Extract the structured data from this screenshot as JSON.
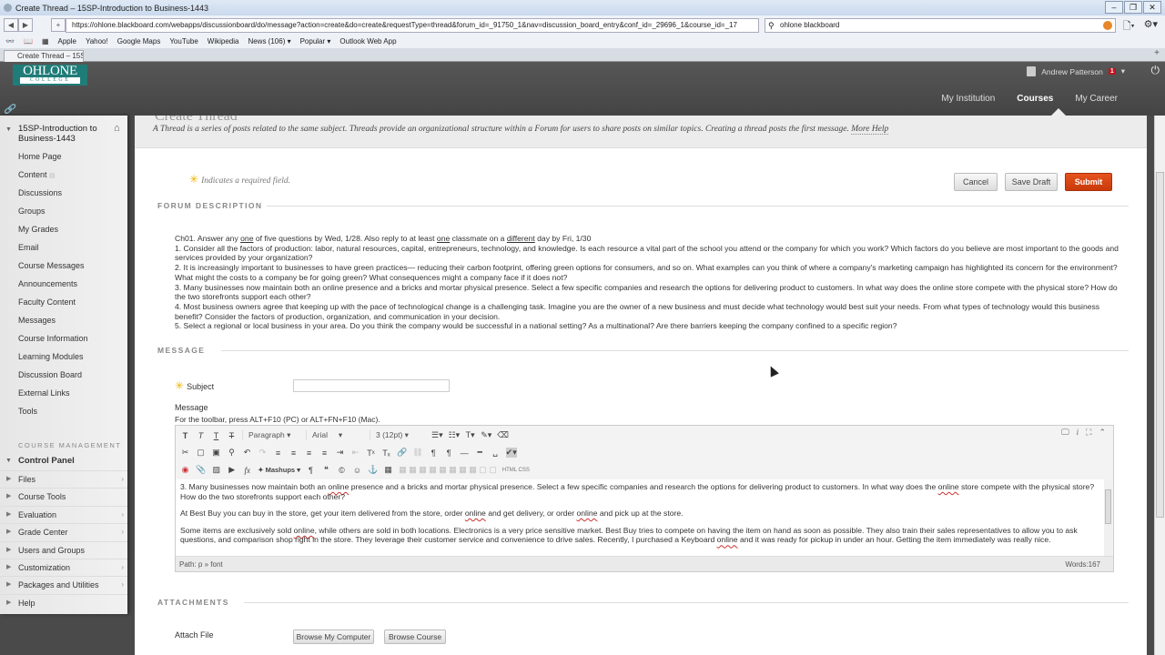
{
  "browser": {
    "window_title": "Create Thread – 15SP-Introduction to Business-1443",
    "url": "https://ohlone.blackboard.com/webapps/discussionboard/do/message?action=create&do=create&requestType=thread&forum_id=_91750_1&nav=discussion_board_entry&conf_id=_29696_1&course_id=_17",
    "search_value": "ohlone blackboard",
    "bookmarks": [
      "Apple",
      "Yahoo!",
      "Google Maps",
      "YouTube",
      "Wikipedia",
      "News (106) ▾",
      "Popular ▾",
      "Outlook Web App"
    ],
    "tab_label": "Create Thread – 15SP-1..."
  },
  "header": {
    "logo_top": "OHLONE",
    "logo_bottom": "COLLEGE",
    "user_name": "Andrew Patterson",
    "notification_count": "1",
    "nav": [
      "My Institution",
      "Courses",
      "My Career"
    ],
    "active_nav": "Courses",
    "brand_color": "#1f7c78"
  },
  "sidebar": {
    "course_title": "15SP-Introduction to Business-1443",
    "items": [
      "Home Page",
      "Content",
      "Discussions",
      "Groups",
      "My Grades",
      "Email",
      "Course Messages",
      "Announcements",
      "Faculty Content",
      "Messages",
      "Course Information",
      "Learning Modules",
      "Discussion Board",
      "External Links",
      "Tools"
    ],
    "management_label": "COURSE MANAGEMENT",
    "control_panel": "Control Panel",
    "cp_items": [
      {
        "label": "Files",
        "chevron": "›"
      },
      {
        "label": "Course Tools",
        "chevron": ""
      },
      {
        "label": "Evaluation",
        "chevron": "›"
      },
      {
        "label": "Grade Center",
        "chevron": "›"
      },
      {
        "label": "Users and Groups",
        "chevron": ""
      },
      {
        "label": "Customization",
        "chevron": "›"
      },
      {
        "label": "Packages and Utilities",
        "chevron": "›"
      },
      {
        "label": "Help",
        "chevron": ""
      }
    ]
  },
  "page": {
    "title": "Create Thread",
    "intro": "A Thread is a series of posts related to the same subject. Threads provide an organizational structure within a Forum for users to share posts on similar topics. Creating a thread posts the first message.",
    "more_help": "More Help",
    "required_note": "Indicates a required field.",
    "buttons": {
      "cancel": "Cancel",
      "save_draft": "Save Draft",
      "submit": "Submit"
    },
    "submit_color": "#d9461a"
  },
  "forum_description": {
    "heading": "FORUM DESCRIPTION",
    "line0_a": "Ch01. Answer any ",
    "line0_u1": "one",
    "line0_b": " of five questions by Wed, 1/28. Also reply to at least ",
    "line0_u2": "one",
    "line0_c": " classmate on a ",
    "line0_u3": "different",
    "line0_d": " day by Fri, 1/30",
    "questions": [
      "1. Consider all the factors of production: labor, natural resources, capital, entrepreneurs, technology, and knowledge. Is each resource a vital part of the school you attend or the company for which you work? Which factors do you believe are most important to the goods and services provided by your organization?",
      "2. It is increasingly important to businesses to have green practices— reducing their carbon footprint, offering green options for consumers, and so on. What examples can you think of where a company's marketing campaign has highlighted its concern for the environment? What might the costs to a company be for going green? What consequences might a company face if it does not?",
      "3. Many businesses now maintain both an online presence and a bricks and mortar physical presence. Select a few specific companies and research the options for delivering product to customers. In what way does the online store compete with the physical store? How do the two storefronts support each other?",
      "4. Most business owners agree that keeping up with the pace of technological change is a challenging task. Imagine you are the owner of a new business and must decide what technology would best suit your needs. From what types of technology would this business benefit? Consider the factors of production, organization, and communication in your decision.",
      "5. Select a regional or local business in your area. Do you think the company would be successful in a national setting? As a multinational? Are there barriers keeping the company confined to a specific region?"
    ]
  },
  "message": {
    "heading": "MESSAGE",
    "subject_label": "Subject",
    "subject_value": "",
    "message_label": "Message",
    "toolbar_hint": "For the toolbar, press ALT+F10 (PC) or ALT+FN+F10 (Mac).",
    "format_select": "Paragraph",
    "font_select": "Arial",
    "size_select": "3 (12pt)",
    "mashups": "Mashups",
    "html_css": "HTML CSS",
    "body": {
      "p1_a": "3. Many businesses now maintain both an ",
      "p1_b": " presence and a bricks and mortar physical presence. Select a few specific companies and research the options for delivering product to customers. In what way does the ",
      "p1_c": " store compete with the physical store? How do the two storefronts support each other?",
      "p2_a": "At Best Buy you can buy in the store, get your item delivered from the store, order ",
      "p2_b": " and get delivery, or order ",
      "p2_c": " and pick up at the store.",
      "p3_a": "Some items are exclusively sold ",
      "p3_b": ", while others are sold in both locations. Electronics is a very price sensitive market. Best Buy tries to compete on having the item on hand as soon as possible. They also train their sales representatives to allow you to ask questions, and comparison shop right in the store. They leverage their customer service and convenience to drive sales. Recently, I purchased a Keyboard ",
      "p3_c": " and it was ready for pickup in under an hour. Getting the item immediately was really nice.",
      "misspelled": "online"
    },
    "path_label": "Path:",
    "path_value": "p » font",
    "word_count": "Words:167"
  },
  "attachments": {
    "heading": "ATTACHMENTS",
    "attach_label": "Attach File",
    "browse_computer": "Browse My Computer",
    "browse_course": "Browse Course"
  }
}
